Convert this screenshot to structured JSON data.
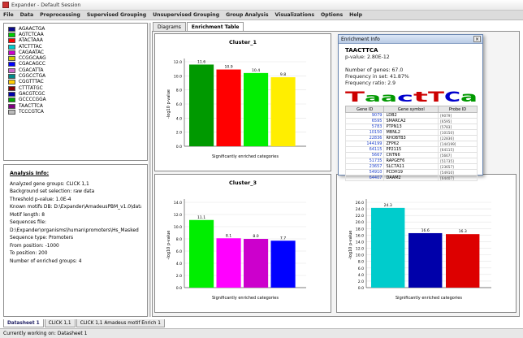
{
  "window": {
    "title": "Expander - Default Session"
  },
  "menu": [
    "File",
    "Data",
    "Preprocessing",
    "Supervised Grouping",
    "Unsupervised Grouping",
    "Group Analysis",
    "Visualizations",
    "Options",
    "Help"
  ],
  "motifs": [
    {
      "seq": "AGAACTGA",
      "color": "#0a0a8c"
    },
    {
      "seq": "AGTCTCAA",
      "color": "#00cc00"
    },
    {
      "seq": "ATACTAAA",
      "color": "#ff0000"
    },
    {
      "seq": "ATCTTTAC",
      "color": "#00cccc"
    },
    {
      "seq": "CAGAATAC",
      "color": "#cc00cc"
    },
    {
      "seq": "CCGGCAAG",
      "color": "#cccc00"
    },
    {
      "seq": "CGACAGCC",
      "color": "#0000ff"
    },
    {
      "seq": "CGACATTA",
      "color": "#cc66cc"
    },
    {
      "seq": "CGGCCTGA",
      "color": "#008888"
    },
    {
      "seq": "CGGTTTAC",
      "color": "#ffcc00"
    },
    {
      "seq": "CTTTATGC",
      "color": "#880000"
    },
    {
      "seq": "GACGTCGC",
      "color": "#0000aa"
    },
    {
      "seq": "GCCCCGGA",
      "color": "#00aa00"
    },
    {
      "seq": "TAACTTCA",
      "color": "#800080"
    },
    {
      "seq": "TCCCGTCA",
      "color": "#bbbbbb"
    }
  ],
  "analysis": {
    "heading": "Analysis Info:",
    "lines": [
      "Analyzed gene groups: CLICK 1,1",
      "Background set selection: raw data",
      "Threshold p-value: 1.0E-4",
      "Known motifs DB: D:\\Expander\\AmadeusPBM_v1.0\\data",
      "Motif length: 8",
      "Sequences file:",
      "D:\\Expander\\organisms\\human\\promoters\\Hs_Masked",
      "Sequence type: Promoters",
      "From position: -1000",
      "To position: 200",
      "Number of enriched groups: 4"
    ]
  },
  "tabs": [
    "Diagrams",
    "Enrichment Table"
  ],
  "bottom_tabs": [
    "Datasheet 1",
    "CLICK 1,1",
    "CLICK 1,1 Amadeus motif Enrich 1"
  ],
  "status": "Currently working on: Datasheet 1",
  "popup": {
    "title": "Enrichment Info",
    "seq": "TAACTTCA",
    "pvalue": "p-value: 2.80E-12",
    "num_genes": "Number of genes: 67.0",
    "freq_set": "Frequency in set: 41.87%",
    "freq_ratio": "Frequency ratio: 2.9",
    "table_headers": [
      "Gene ID",
      "Gene symbol",
      "Probe ID"
    ],
    "rows": [
      [
        "9079",
        "LDB2",
        "[9079]"
      ],
      [
        "6595",
        "SMARCA2",
        "[6595]"
      ],
      [
        "5783",
        "PTPN13",
        "[5783]"
      ],
      [
        "10150",
        "MBNL2",
        "[10150]"
      ],
      [
        "22836",
        "RHOBTB3",
        "[22836]"
      ],
      [
        "144199",
        "ZFP62",
        "[144199]"
      ],
      [
        "64115",
        "PP2115",
        "[64115]"
      ],
      [
        "5667",
        "CNTN6",
        "[5667]"
      ],
      [
        "51735",
        "RAPGEF6",
        "[51735]"
      ],
      [
        "23657",
        "SLC7A11",
        "[23657]"
      ],
      [
        "54910",
        "PCDH19",
        "[54910]"
      ],
      [
        "64407",
        "DAAM2",
        "[64407]"
      ]
    ]
  },
  "chart_data": [
    {
      "type": "bar",
      "title": "Cluster_1",
      "ylabel": "-log10 p-value",
      "xlabel": "Significantly enriched categories",
      "ylim": [
        0,
        12
      ],
      "ticks": [
        "0.0",
        "2.0",
        "4.0",
        "6.0",
        "8.0",
        "10.0",
        "12.0"
      ],
      "values": [
        11.6,
        10.9,
        10.4,
        9.8
      ],
      "labels": [
        "11.6",
        "10.9",
        "10.4",
        "9.8"
      ],
      "colors": [
        "#009900",
        "#ff0000",
        "#00ee00",
        "#ffee00"
      ]
    },
    {
      "type": "bar",
      "title": "Cluster_3",
      "ylabel": "-log10 p-value",
      "xlabel": "Significantly enriched categories",
      "ylim": [
        0,
        14
      ],
      "ticks": [
        "0.0",
        "2.0",
        "4.0",
        "6.0",
        "8.0",
        "10.0",
        "12.0",
        "14.0"
      ],
      "values": [
        11.1,
        8.1,
        8.0,
        7.7
      ],
      "labels": [
        "11.1",
        "8.1",
        "8.0",
        "7.7"
      ],
      "colors": [
        "#00ee00",
        "#ff00ff",
        "#cc00cc",
        "#0000ff"
      ]
    },
    {
      "type": "bar",
      "title": "",
      "ylabel": "-log10 p-value",
      "xlabel": "Significantly enriched categories",
      "ylim": [
        0,
        26
      ],
      "ticks": [
        "0.0",
        "2.0",
        "4.0",
        "6.0",
        "8.0",
        "10.0",
        "12.0",
        "14.0",
        "16.0",
        "18.0",
        "20.0",
        "22.0",
        "24.0",
        "26.0"
      ],
      "values": [
        24.3,
        16.6,
        16.3
      ],
      "labels": [
        "24.3",
        "16.6",
        "16.3"
      ],
      "colors": [
        "#00cccc",
        "#0000aa",
        "#dd0000"
      ]
    }
  ]
}
